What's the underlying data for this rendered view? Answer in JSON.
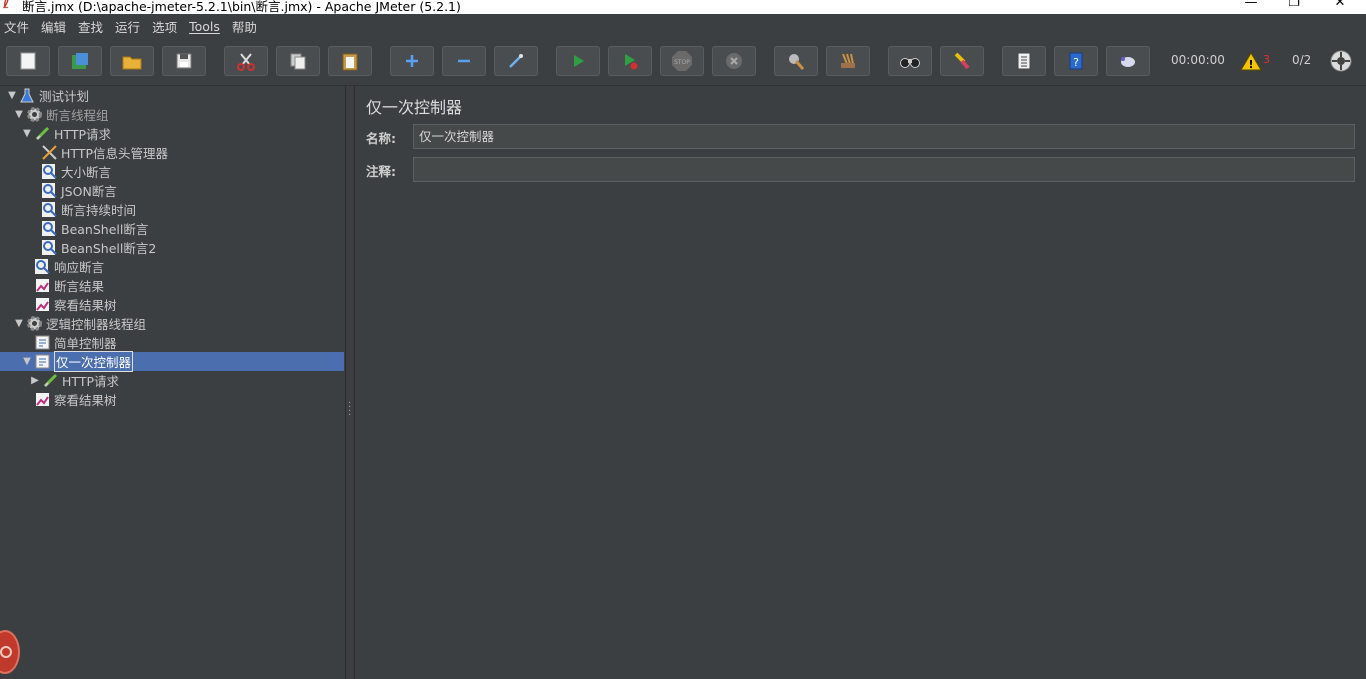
{
  "window": {
    "title": "断言.jmx (D:\\apache-jmeter-5.2.1\\bin\\断言.jmx) - Apache JMeter (5.2.1)",
    "minimize": "—",
    "maximize": "❐",
    "close": "✕"
  },
  "menubar": [
    "文件",
    "编辑",
    "查找",
    "运行",
    "选项",
    "Tools",
    "帮助"
  ],
  "toolbar": {
    "buttons": [
      "new",
      "templates",
      "open",
      "save",
      "cut",
      "copy",
      "paste",
      "expand",
      "collapse",
      "toggle",
      "start",
      "start-no-pauses",
      "stop",
      "shutdown",
      "clear",
      "clear-all",
      "search",
      "reset-search",
      "function-helper",
      "help",
      "remote"
    ],
    "timer": "00:00:00",
    "warning_count": "3",
    "threads": "0/2"
  },
  "tree": [
    {
      "label": "测试计划",
      "icon": "flask-icon",
      "toggle": "▼",
      "indent": 0
    },
    {
      "label": "断言线程组",
      "icon": "gear-icon",
      "toggle": "▼",
      "indent": 1,
      "dim": true
    },
    {
      "label": "HTTP请求",
      "icon": "pipette-icon",
      "toggle": "▼",
      "indent": 2
    },
    {
      "label": "HTTP信息头管理器",
      "icon": "tools-icon",
      "toggle": "",
      "indent": 3
    },
    {
      "label": "大小断言",
      "icon": "magnifier-icon",
      "toggle": "",
      "indent": 3
    },
    {
      "label": "JSON断言",
      "icon": "magnifier-icon",
      "toggle": "",
      "indent": 3
    },
    {
      "label": "断言持续时间",
      "icon": "magnifier-icon",
      "toggle": "",
      "indent": 3
    },
    {
      "label": "BeanShell断言",
      "icon": "magnifier-icon",
      "toggle": "",
      "indent": 3
    },
    {
      "label": "BeanShell断言2",
      "icon": "magnifier-icon",
      "toggle": "",
      "indent": 3
    },
    {
      "label": "响应断言",
      "icon": "magnifier-icon",
      "toggle": "",
      "indent": 2
    },
    {
      "label": "断言结果",
      "icon": "graph-icon",
      "toggle": "",
      "indent": 2
    },
    {
      "label": "察看结果树",
      "icon": "graph-icon",
      "toggle": "",
      "indent": 2
    },
    {
      "label": "逻辑控制器线程组",
      "icon": "gear-icon",
      "toggle": "▼",
      "indent": 1
    },
    {
      "label": "简单控制器",
      "icon": "controller-icon",
      "toggle": "",
      "indent": 2
    },
    {
      "label": "仅一次控制器",
      "icon": "controller-icon",
      "toggle": "▼",
      "indent": 2,
      "selected": true
    },
    {
      "label": "HTTP请求",
      "icon": "pipette-icon",
      "toggle": "▶",
      "indent": 3
    },
    {
      "label": "察看结果树",
      "icon": "graph-icon",
      "toggle": "",
      "indent": 2
    }
  ],
  "form": {
    "title": "仅一次控制器",
    "name_label": "名称:",
    "name_value": "仅一次控制器",
    "comment_label": "注释:",
    "comment_value": ""
  },
  "colors": {
    "background": "#3c3f41",
    "selection": "#4b6eaf",
    "start_green": "#2ea043",
    "warning_yellow": "#f5c400"
  }
}
